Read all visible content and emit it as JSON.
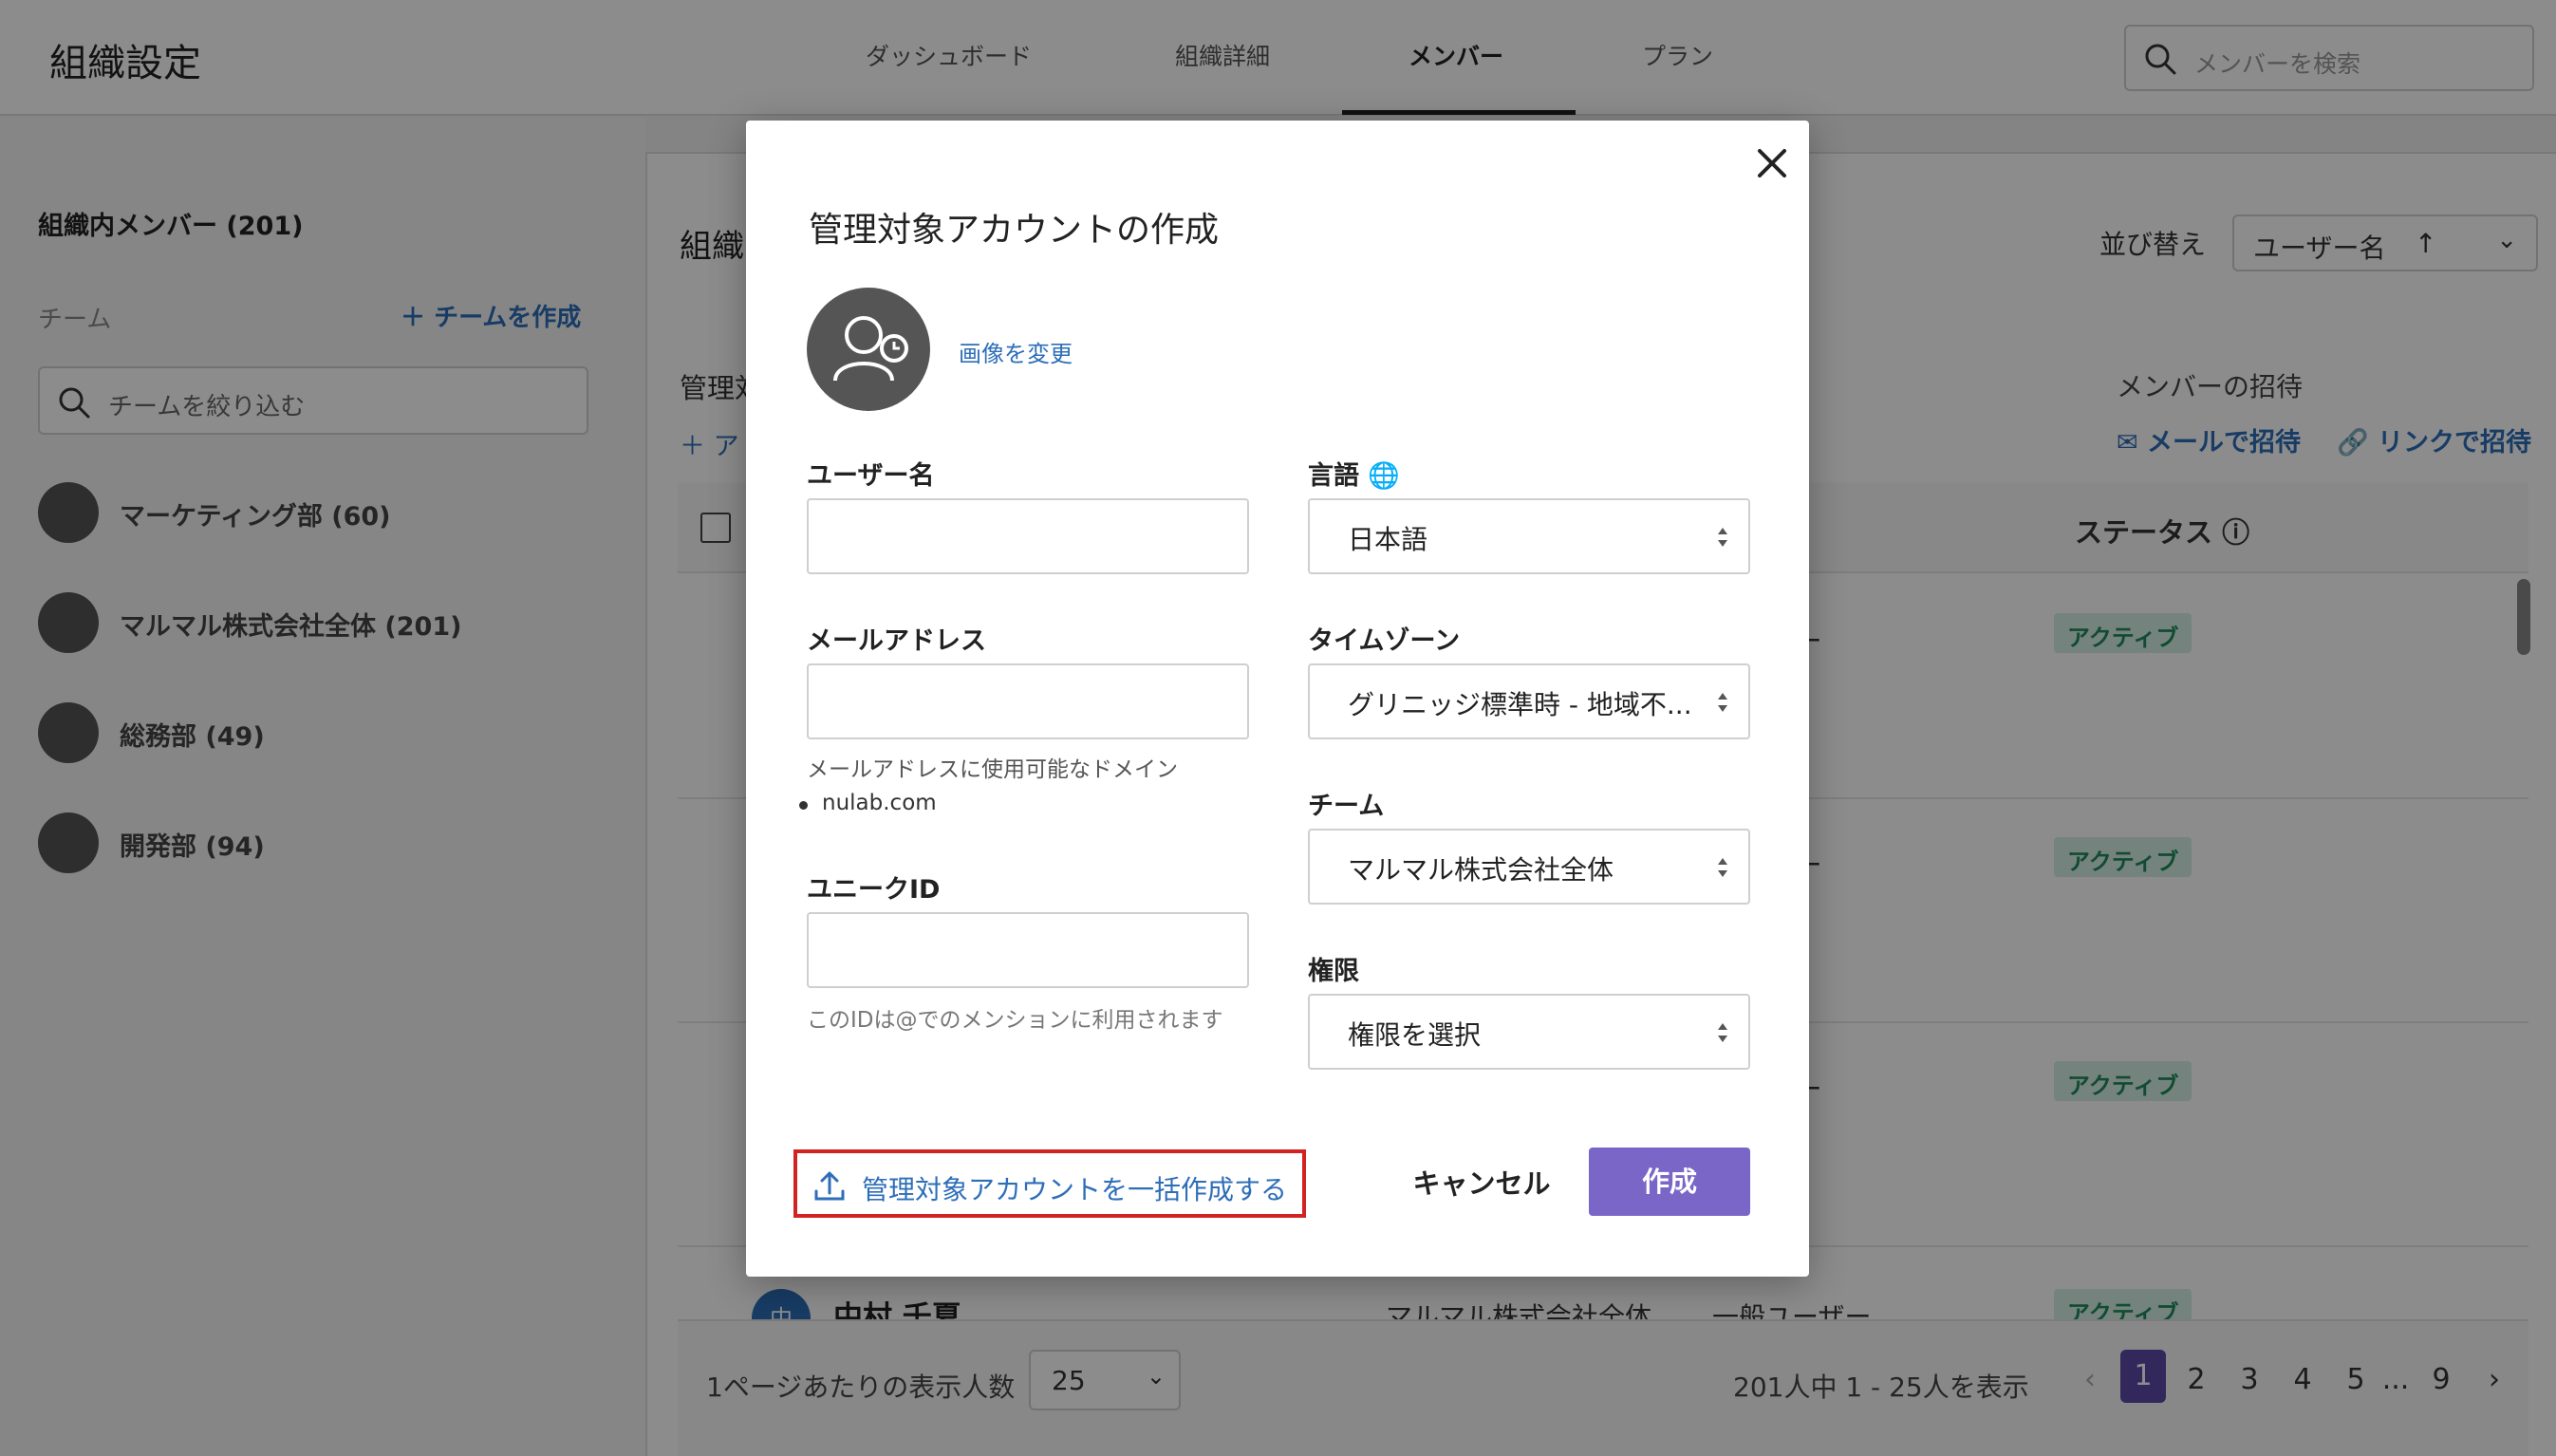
{
  "header": {
    "title": "組織設定",
    "tabs": [
      {
        "label": "ダッシュボード"
      },
      {
        "label": "組織詳細"
      },
      {
        "label": "メンバー"
      },
      {
        "label": "プラン"
      }
    ],
    "active_tab": "メンバー",
    "search_placeholder": "メンバーを検索"
  },
  "sidebar": {
    "heading": "組織内メンバー (201)",
    "team_label": "チーム",
    "create_team": "チームを作成",
    "filter_placeholder": "チームを絞り込む",
    "teams": [
      {
        "label": "マーケティング部 (60)"
      },
      {
        "label": "マルマル株式会社全体 (201)"
      },
      {
        "label": "総務部 (49)"
      },
      {
        "label": "開発部 (94)"
      }
    ]
  },
  "main": {
    "title_fragment": "組織",
    "subheading_fragment": "管理対",
    "add_fragment": "ア",
    "sort_label": "並び替え",
    "sort_value": "ユーザー名",
    "invite_label": "メンバーの招待",
    "invite_mail": "メールで招待",
    "invite_link": "リンクで招待",
    "status_header": "ステータス",
    "rows": [
      {
        "role_fragment": "ーザー",
        "status": "アクティブ"
      },
      {
        "role_fragment": "ーザー",
        "status": "アクティブ"
      },
      {
        "role_fragment": "ーザー",
        "status": "アクティブ"
      }
    ],
    "last_row": {
      "avatar_initial": "中",
      "name": "中村 千夏",
      "team": "マルマル株式会社全体",
      "role": "一般ユーザー",
      "status": "アクティブ"
    }
  },
  "pagination": {
    "per_page_label": "1ページあたりの表示人数",
    "per_page_value": "25",
    "range_text": "201人中 1 - 25人を表示",
    "pages": [
      "1",
      "2",
      "3",
      "4",
      "5",
      "...",
      "9"
    ],
    "current_page": "1"
  },
  "modal": {
    "title": "管理対象アカウントの作成",
    "change_image": "画像を変更",
    "username_label": "ユーザー名",
    "username_value": "",
    "email_label": "メールアドレス",
    "email_value": "",
    "email_domain_hint": "メールアドレスに使用可能なドメイン",
    "email_domain": "nulab.com",
    "unique_id_label": "ユニークID",
    "unique_id_value": "",
    "unique_id_hint": "このIDは@でのメンションに利用されます",
    "language_label": "言語",
    "language_value": "日本語",
    "timezone_label": "タイムゾーン",
    "timezone_value": "グリニッジ標準時 - 地域不...",
    "team_label": "チーム",
    "team_value": "マルマル株式会社全体",
    "permission_label": "権限",
    "permission_value": "権限を選択",
    "bulk_create": "管理対象アカウントを一括作成する",
    "cancel": "キャンセル",
    "create": "作成"
  },
  "colors": {
    "accent": "#7a66c7",
    "link": "#2d6eb8",
    "highlight_border": "#d32222",
    "status_active_bg": "#d6efe5",
    "status_active_text": "#1f8a5c"
  }
}
